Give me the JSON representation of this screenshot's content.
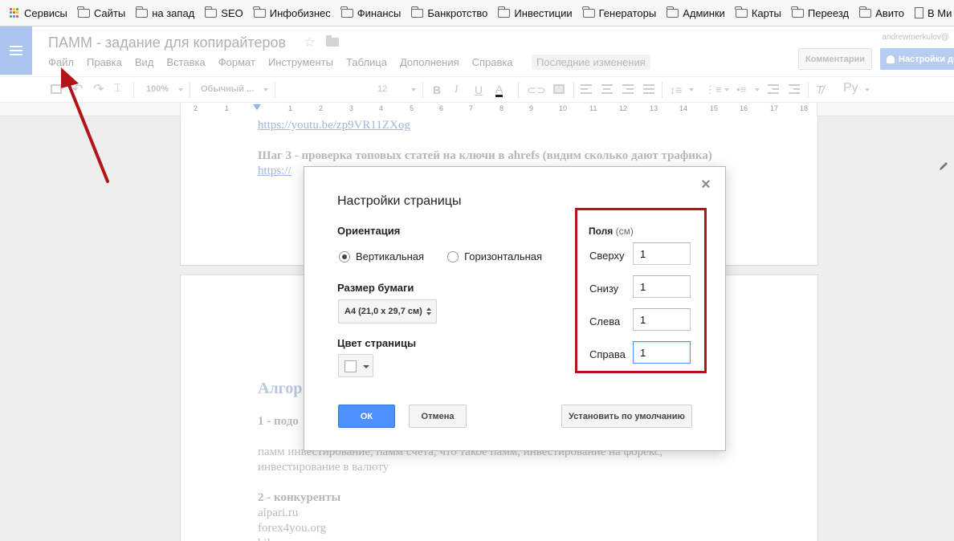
{
  "bookmarks": {
    "apps_label": "Сервисы",
    "items": [
      "Сайты",
      "на запад",
      "SEO",
      "Инфобизнес",
      "Финансы",
      "Банкротство",
      "Инвестиции",
      "Генераторы",
      "Админки",
      "Карты",
      "Переезд",
      "Авито"
    ],
    "last_item": "В Ми"
  },
  "header": {
    "doc_title": "ПАММ - задание для копирайтеров",
    "menu": [
      "Файл",
      "Правка",
      "Вид",
      "Вставка",
      "Формат",
      "Инструменты",
      "Таблица",
      "Дополнения",
      "Справка"
    ],
    "last_changes": "Последние изменения",
    "user_email": "andrewmerkulov@",
    "comments_label": "Комментарии",
    "share_label": "Настройки до"
  },
  "toolbar": {
    "zoom": "100%",
    "style": "Обычный ...",
    "font_size": "12",
    "bold": "B",
    "italic": "I",
    "underline": "U",
    "text_color": "A",
    "input_tools": "Ру"
  },
  "ruler": {
    "numbers": [
      "2",
      "1",
      "1",
      "2",
      "3",
      "4",
      "5",
      "6",
      "7",
      "8",
      "9",
      "10",
      "11",
      "12",
      "13",
      "14",
      "15",
      "16",
      "17",
      "18"
    ]
  },
  "document": {
    "link1": "https://youtu.be/zp9VR11ZXog",
    "step3": "Шаг 3 - проверка топовых статей на ключи в ahrefs (видим сколько дают трафика)",
    "link2": "https://",
    "heading": "Алгор",
    "item1": "1  - подо",
    "keywords_line1": "памм инвестирование, памм счета, что такое памм, инвестирование на форекс,",
    "keywords_line2": "инвестирование в валюту",
    "competitors": "2 - конкуренты",
    "comp1": "alpari.ru",
    "comp2": "forex4you.org",
    "comp3": "bil"
  },
  "dialog": {
    "title": "Настройки страницы",
    "close": "×",
    "orientation_label": "Ориентация",
    "portrait": "Вертикальная",
    "landscape": "Горизонтальная",
    "selected_orientation": "portrait",
    "paper_label": "Размер бумаги",
    "paper_value": "A4 (21,0 x 29,7 см)",
    "color_label": "Цвет страницы",
    "page_color": "#ffffff",
    "margins": {
      "title": "Поля",
      "unit": "(см)",
      "top_label": "Сверху",
      "top_value": "1",
      "bottom_label": "Снизу",
      "bottom_value": "1",
      "left_label": "Слева",
      "left_value": "1",
      "right_label": "Справа",
      "right_value": "1"
    },
    "ok_label": "ОК",
    "cancel_label": "Отмена",
    "default_label": "Установить по умолчанию"
  },
  "colors": {
    "accent_blue": "#4d90fe",
    "highlight_red": "#b2141a"
  }
}
